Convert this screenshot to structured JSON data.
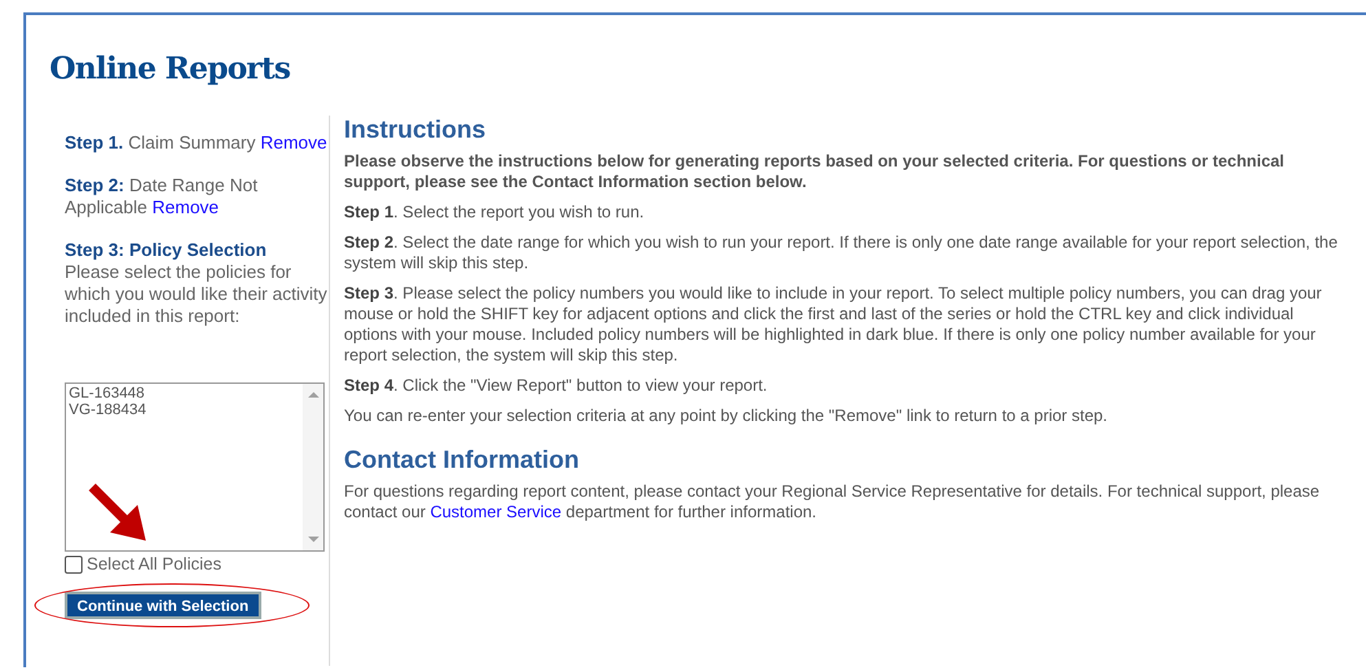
{
  "title": "Online Reports",
  "sidebar": {
    "steps": [
      {
        "label": "Step 1.",
        "text": "Claim Summary",
        "link": "Remove"
      },
      {
        "label": "Step 2:",
        "text": "Date Range Not Applicable",
        "link": "Remove"
      },
      {
        "label": "Step 3: Policy Selection",
        "text": "Please select the policies for which you would like their activity included in this report:"
      }
    ],
    "policies": [
      {
        "label": "GL-163448",
        "selected": false
      },
      {
        "label": "VG-188434",
        "selected": false
      }
    ],
    "select_all": {
      "label": "Select All Policies",
      "checked": false
    },
    "button": "Continue with Selection"
  },
  "instructions": {
    "heading": "Instructions",
    "intro": "Please observe the instructions below for generating reports based on your selected criteria. For questions or technical support, please see the Contact Information section below.",
    "paragraphs": [
      "**Step 1**. Select the report you wish to run.",
      "**Step 2**. Select the date range for which you wish to run your report.  If there is only one date range available for your report selection, the system will skip this step.",
      "**Step 3**. Please select the policy numbers you would like to include in your report. To select multiple policy numbers, you can drag your mouse or hold the SHIFT key for adjacent options and click the first and last of the series or hold the CTRL key and click individual options with your mouse.  Included policy numbers will be highlighted in dark blue. If there is only one policy number available for your report selection, the system will skip this step.",
      "**Step 4**. Click the \"View Report\" button to view your report.",
      "You can re-enter your selection criteria at any point by clicking the \"Remove\" link to return to a prior step."
    ]
  },
  "contact": {
    "heading": "Contact Information",
    "before": "For questions regarding report content, please contact your Regional Service Representative for details. For technical support, please contact our",
    "link": "Customer Service",
    "after": "department for further information."
  }
}
